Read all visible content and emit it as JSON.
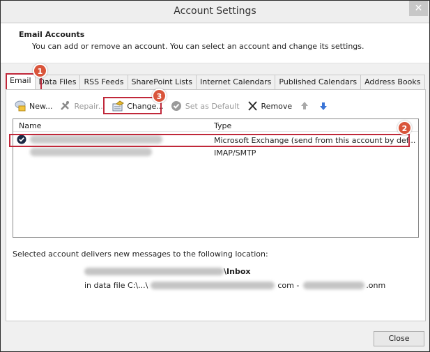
{
  "window": {
    "title": "Account Settings",
    "close_label": "✕"
  },
  "header": {
    "title": "Email Accounts",
    "description": "You can add or remove an account. You can select an account and change its settings."
  },
  "tabs": [
    {
      "label": "Email",
      "active": true
    },
    {
      "label": "Data Files",
      "active": false
    },
    {
      "label": "RSS Feeds",
      "active": false
    },
    {
      "label": "SharePoint Lists",
      "active": false
    },
    {
      "label": "Internet Calendars",
      "active": false
    },
    {
      "label": "Published Calendars",
      "active": false
    },
    {
      "label": "Address Books",
      "active": false
    }
  ],
  "toolbar": {
    "new_label": "New...",
    "repair_label": "Repair...",
    "change_label": "Change...",
    "set_default_label": "Set as Default",
    "remove_label": "Remove",
    "icons": {
      "new": "new-account-icon",
      "repair": "repair-tools-icon",
      "change": "change-account-icon",
      "set_default": "checkmark-circle-icon",
      "remove": "x-icon",
      "move_up": "arrow-up-icon",
      "move_down": "arrow-down-icon"
    }
  },
  "accounts_list": {
    "columns": {
      "name": "Name",
      "type": "Type"
    },
    "rows": [
      {
        "name": "[redacted email]",
        "type": "Microsoft Exchange (send from this account by def...",
        "default": true,
        "selected": true
      },
      {
        "name": "[redacted email]",
        "type": "IMAP/SMTP",
        "default": false,
        "selected": false
      }
    ]
  },
  "delivery": {
    "label": "Selected account delivers new messages to the following location:",
    "folder_suffix": "\\Inbox",
    "data_file_prefix": "in data file C:\\...\\",
    "data_file_mid": "com -",
    "data_file_suffix": ".onm"
  },
  "annotations": {
    "badge_1": "1",
    "badge_2": "2",
    "badge_3": "3",
    "highlight_color": "#c0283a",
    "badge_color": "#d9553b"
  },
  "footer": {
    "close_label": "Close"
  }
}
